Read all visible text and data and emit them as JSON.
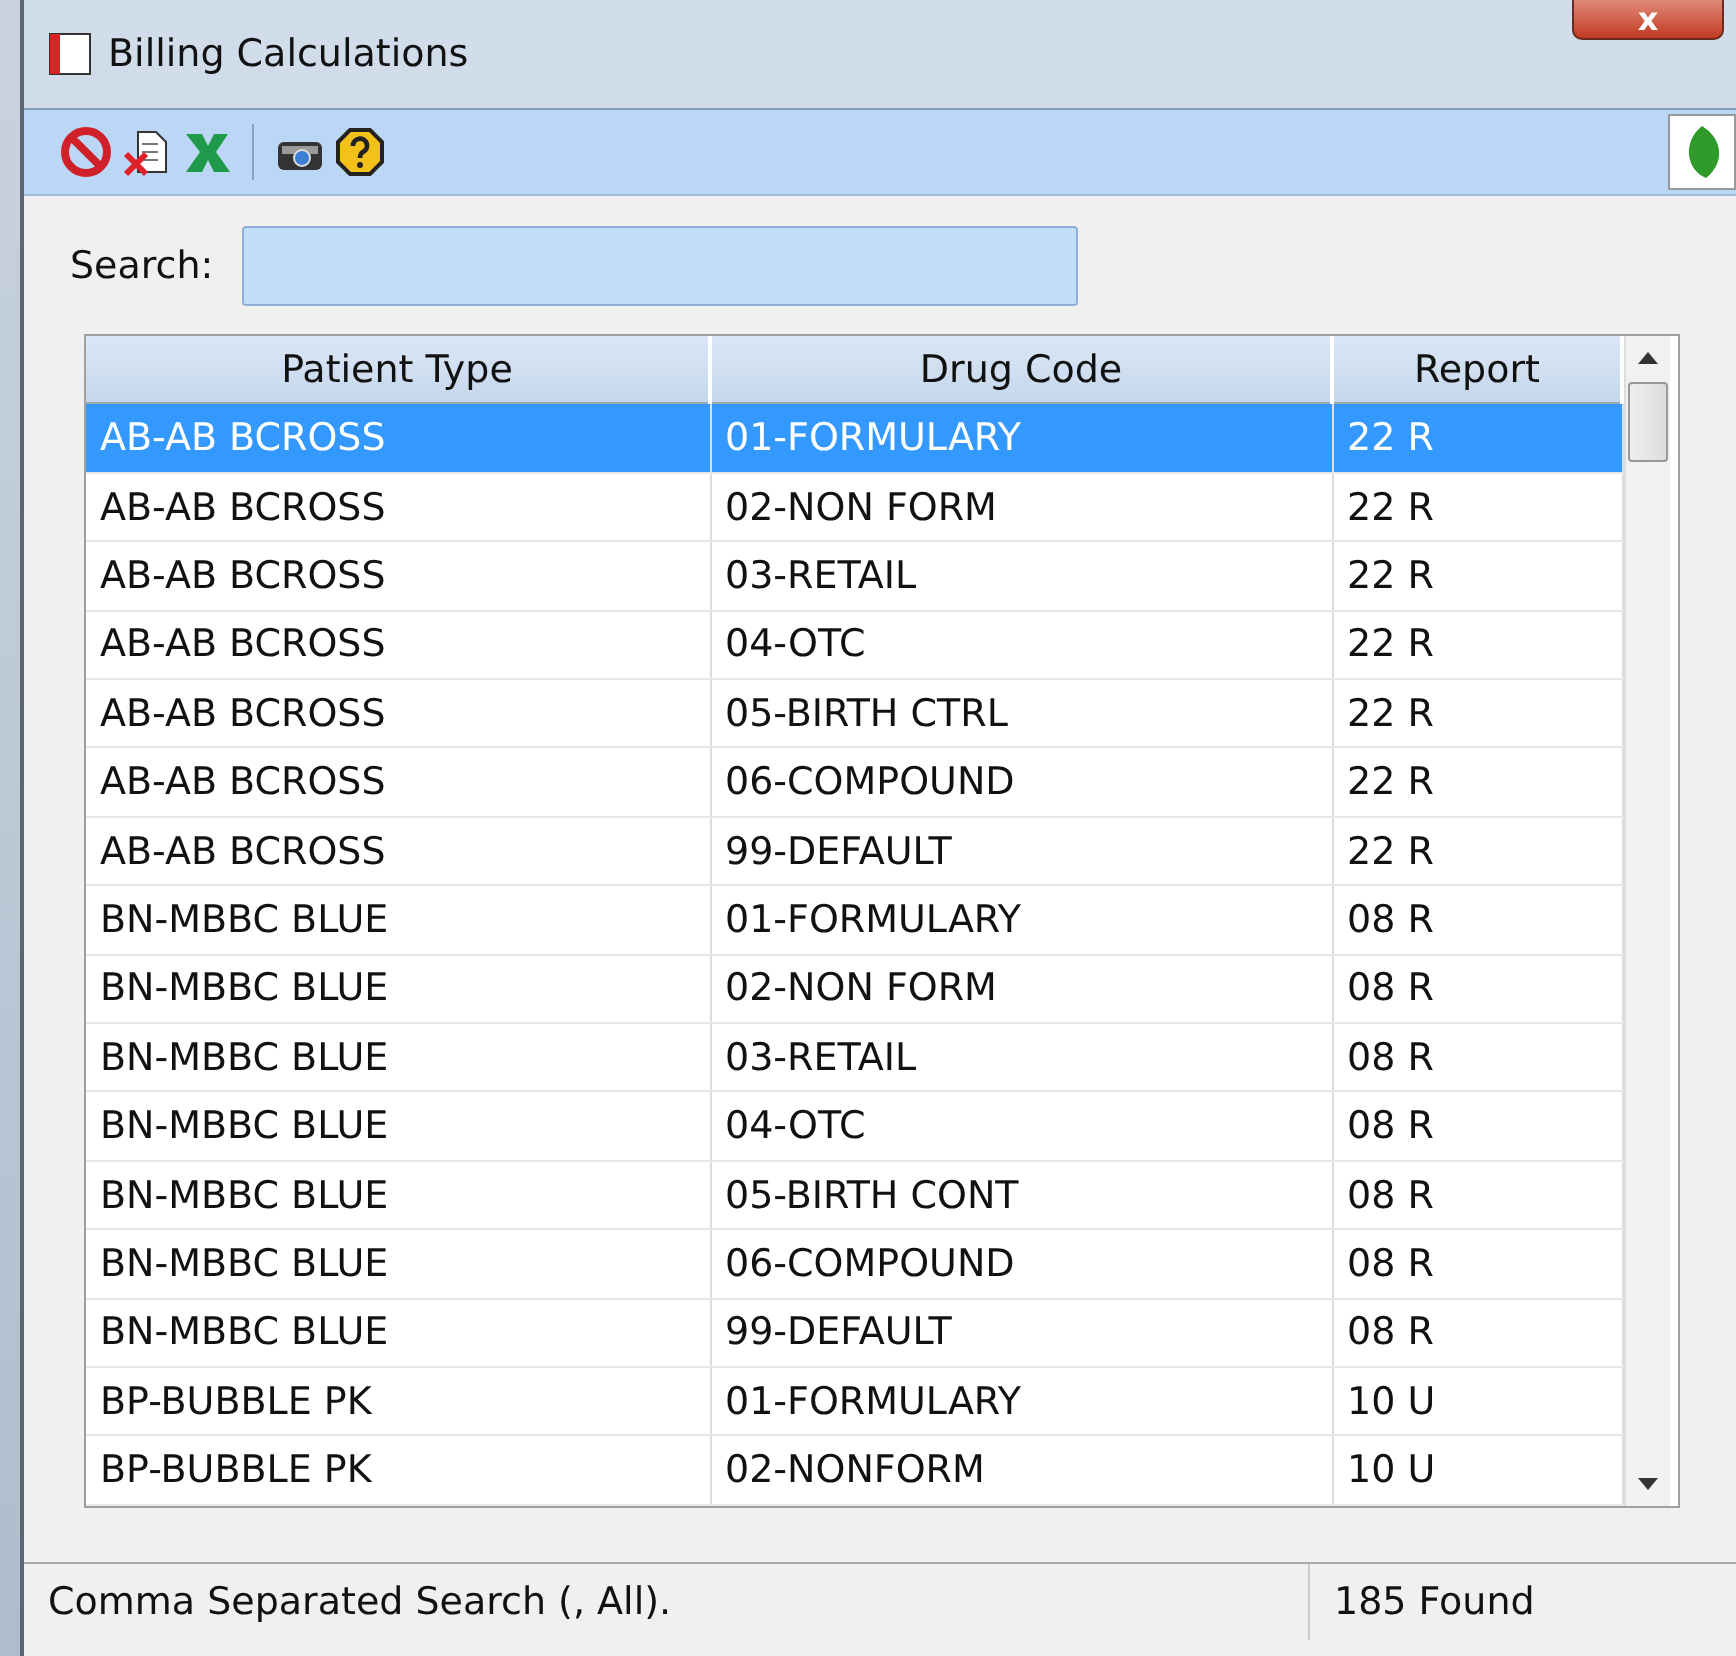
{
  "window": {
    "title": "Billing Calculations",
    "close": "x"
  },
  "toolbar": {
    "buttons": [
      {
        "kind": "cancel"
      },
      {
        "kind": "delete"
      },
      {
        "kind": "excel"
      },
      {
        "kind": "separator"
      },
      {
        "kind": "camera"
      },
      {
        "kind": "help"
      }
    ]
  },
  "search": {
    "label": "Search:"
  },
  "table": {
    "columns": [
      "Patient Type",
      "Drug Code",
      "Report"
    ],
    "rows": [
      {
        "cells": [
          "AB-AB BCROSS",
          "01-FORMULARY",
          "22 R"
        ],
        "selected": true
      },
      {
        "cells": [
          "AB-AB BCROSS",
          "02-NON FORM",
          "22 R"
        ],
        "selected": false
      },
      {
        "cells": [
          "AB-AB BCROSS",
          "03-RETAIL",
          "22 R"
        ],
        "selected": false
      },
      {
        "cells": [
          "AB-AB BCROSS",
          "04-OTC",
          "22 R"
        ],
        "selected": false
      },
      {
        "cells": [
          "AB-AB BCROSS",
          "05-BIRTH CTRL",
          "22 R"
        ],
        "selected": false
      },
      {
        "cells": [
          "AB-AB BCROSS",
          "06-COMPOUND",
          "22 R"
        ],
        "selected": false
      },
      {
        "cells": [
          "AB-AB BCROSS",
          "99-DEFAULT",
          "22 R"
        ],
        "selected": false
      },
      {
        "cells": [
          "BN-MBBC BLUE",
          "01-FORMULARY",
          "08 R"
        ],
        "selected": false
      },
      {
        "cells": [
          "BN-MBBC BLUE",
          "02-NON FORM",
          "08 R"
        ],
        "selected": false
      },
      {
        "cells": [
          "BN-MBBC BLUE",
          "03-RETAIL",
          "08 R"
        ],
        "selected": false
      },
      {
        "cells": [
          "BN-MBBC BLUE",
          "04-OTC",
          "08 R"
        ],
        "selected": false
      },
      {
        "cells": [
          "BN-MBBC BLUE",
          "05-BIRTH CONT",
          "08 R"
        ],
        "selected": false
      },
      {
        "cells": [
          "BN-MBBC BLUE",
          "06-COMPOUND",
          "08 R"
        ],
        "selected": false
      },
      {
        "cells": [
          "BN-MBBC BLUE",
          "99-DEFAULT",
          "08 R"
        ],
        "selected": false
      },
      {
        "cells": [
          "BP-BUBBLE PK",
          "01-FORMULARY",
          "10 U"
        ],
        "selected": false
      },
      {
        "cells": [
          "BP-BUBBLE PK",
          "02-NONFORM",
          "10 U"
        ],
        "selected": false
      }
    ]
  },
  "status_bar": {
    "hint": "Comma Separated Search (, All).",
    "count": "185 Found"
  }
}
